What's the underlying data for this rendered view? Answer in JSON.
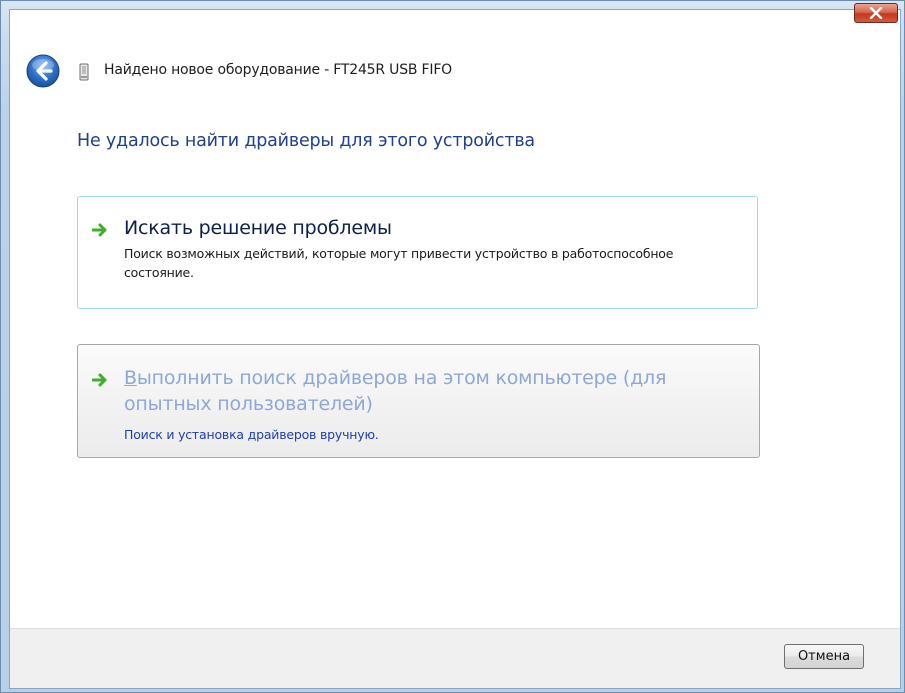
{
  "window": {
    "title": "Найдено новое оборудование - FT245R USB FIFO"
  },
  "main": {
    "heading": "Не удалось найти драйверы для этого устройства",
    "options": [
      {
        "title": "Искать решение проблемы",
        "description": "Поиск возможных действий, которые могут привести устройство в работоспособное состояние."
      },
      {
        "title_accel": "В",
        "title_rest": "ыполнить поиск драйверов на этом компьютере (для опытных пользователей)",
        "description": "Поиск и установка драйверов вручную."
      }
    ]
  },
  "footer": {
    "cancel_label": "Отмена"
  },
  "colors": {
    "heading": "#1f3f8f",
    "option_hover_border": "#9fd8ea",
    "arrow_green": "#3fae2a",
    "link_blue": "#1b3fb8",
    "close_red": "#c3381e"
  },
  "icons": {
    "back": "back-arrow-icon",
    "device": "usb-device-icon",
    "option_arrow": "green-arrow-icon",
    "close": "close-icon"
  }
}
